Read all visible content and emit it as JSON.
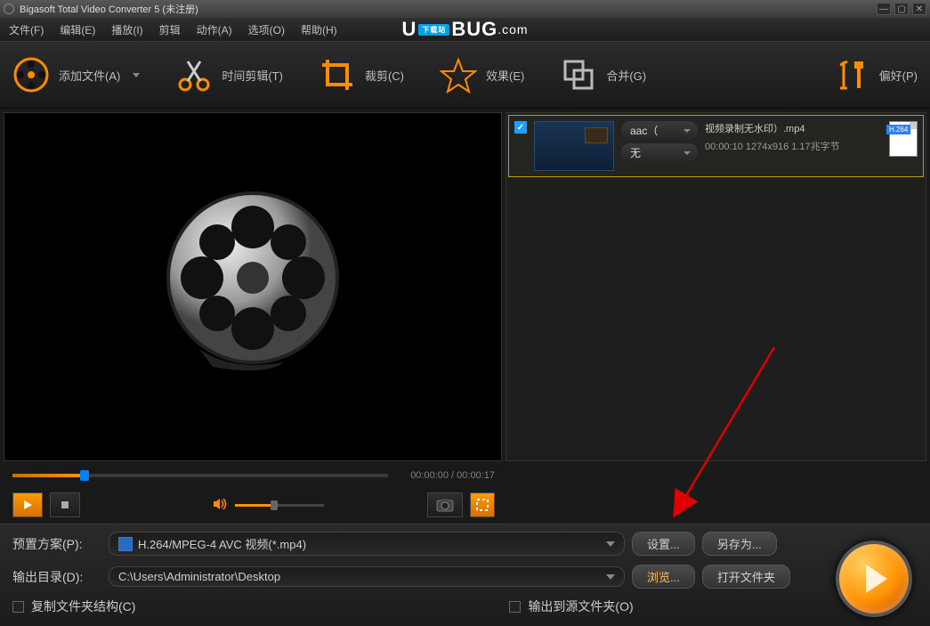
{
  "title": "Bigasoft Total Video Converter 5 (未注册)",
  "menu": {
    "file": "文件(F)",
    "edit": "编辑(E)",
    "play": "播放(I)",
    "trim": "剪辑",
    "action": "动作(A)",
    "option": "选项(O)",
    "help": "帮助(H)"
  },
  "watermark": {
    "pre": "U",
    "badge": "下载站",
    "mid": "BUG",
    "suf": ".com"
  },
  "toolbar": {
    "add": "添加文件(A)",
    "trim": "时间剪辑(T)",
    "crop": "裁剪(C)",
    "effect": "效果(E)",
    "merge": "合并(G)",
    "pref": "偏好(P)"
  },
  "file": {
    "checked": true,
    "audio": "aac（",
    "sub": "无",
    "name": "视频录制无水印）.mp4",
    "meta": "00:00:10  1274x916  1.17兆字节",
    "codec": "H.264"
  },
  "time": "00:00:00 / 00:00:17",
  "bottom": {
    "preset_label": "预置方案(P):",
    "preset_value": "H.264/MPEG-4 AVC 视频(*.mp4)",
    "settings": "设置...",
    "saveas": "另存为...",
    "output_label": "输出目录(D):",
    "output_value": "C:\\Users\\Administrator\\Desktop",
    "browse": "浏览...",
    "open": "打开文件夹",
    "copy_struct": "复制文件夹结构(C)",
    "to_source": "输出到源文件夹(O)"
  }
}
